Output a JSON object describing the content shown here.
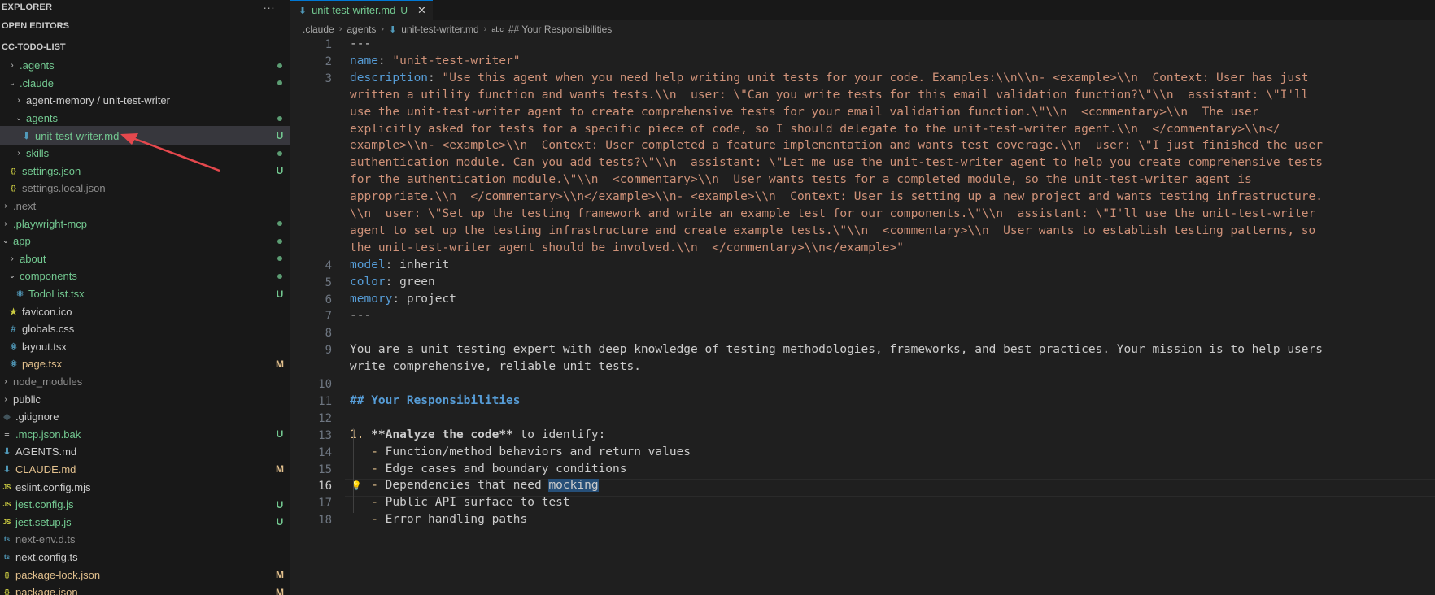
{
  "sidebar": {
    "header": "EXPLORER",
    "header_more": "···",
    "open_editors": "OPEN EDITORS",
    "project": "CC-TODO-LIST",
    "items": [
      {
        "label": ".agents",
        "indent": 1,
        "kind": "folder",
        "chevron": "›",
        "color": "g",
        "status": "dot"
      },
      {
        "label": ".claude",
        "indent": 1,
        "kind": "folder",
        "chevron": "⌄",
        "color": "g",
        "status": "dot"
      },
      {
        "label": "agent-memory / unit-test-writer",
        "indent": 2,
        "kind": "folder",
        "chevron": "›",
        "color": "",
        "status": ""
      },
      {
        "label": "agents",
        "indent": 2,
        "kind": "folder",
        "chevron": "⌄",
        "color": "g",
        "status": "dot"
      },
      {
        "label": "unit-test-writer.md",
        "indent": 3,
        "kind": "md",
        "chevron": "",
        "color": "g",
        "status": "U",
        "active": true
      },
      {
        "label": "skills",
        "indent": 2,
        "kind": "folder",
        "chevron": "›",
        "color": "g",
        "status": "dot"
      },
      {
        "label": "settings.json",
        "indent": 1,
        "kind": "json",
        "chevron": "",
        "color": "g",
        "status": "U"
      },
      {
        "label": "settings.local.json",
        "indent": 1,
        "kind": "json",
        "chevron": "",
        "color": "dim",
        "status": ""
      },
      {
        "label": ".next",
        "indent": 0,
        "kind": "folder",
        "chevron": "›",
        "color": "dim",
        "status": ""
      },
      {
        "label": ".playwright-mcp",
        "indent": 0,
        "kind": "folder",
        "chevron": "›",
        "color": "g",
        "status": "dot"
      },
      {
        "label": "app",
        "indent": 0,
        "kind": "folder",
        "chevron": "⌄",
        "color": "g",
        "status": "dot"
      },
      {
        "label": "about",
        "indent": 1,
        "kind": "folder",
        "chevron": "›",
        "color": "g",
        "status": "dot"
      },
      {
        "label": "components",
        "indent": 1,
        "kind": "folder",
        "chevron": "⌄",
        "color": "g",
        "status": "dot"
      },
      {
        "label": "TodoList.tsx",
        "indent": 2,
        "kind": "tsx",
        "chevron": "",
        "color": "g",
        "status": "U"
      },
      {
        "label": "favicon.ico",
        "indent": 1,
        "kind": "ico",
        "chevron": "",
        "color": "",
        "status": ""
      },
      {
        "label": "globals.css",
        "indent": 1,
        "kind": "css",
        "chevron": "",
        "color": "",
        "status": ""
      },
      {
        "label": "layout.tsx",
        "indent": 1,
        "kind": "tsx",
        "chevron": "",
        "color": "",
        "status": ""
      },
      {
        "label": "page.tsx",
        "indent": 1,
        "kind": "tsx",
        "chevron": "",
        "color": "y",
        "status": "M"
      },
      {
        "label": "node_modules",
        "indent": 0,
        "kind": "folder",
        "chevron": "›",
        "color": "dim",
        "status": ""
      },
      {
        "label": "public",
        "indent": 0,
        "kind": "folder",
        "chevron": "›",
        "color": "",
        "status": ""
      },
      {
        "label": ".gitignore",
        "indent": 0,
        "kind": "git",
        "chevron": "",
        "color": "",
        "status": ""
      },
      {
        "label": ".mcp.json.bak",
        "indent": 0,
        "kind": "bak",
        "chevron": "",
        "color": "g",
        "status": "U"
      },
      {
        "label": "AGENTS.md",
        "indent": 0,
        "kind": "md",
        "chevron": "",
        "color": "",
        "status": ""
      },
      {
        "label": "CLAUDE.md",
        "indent": 0,
        "kind": "md",
        "chevron": "",
        "color": "y",
        "status": "M"
      },
      {
        "label": "eslint.config.mjs",
        "indent": 0,
        "kind": "js",
        "chevron": "",
        "color": "",
        "status": ""
      },
      {
        "label": "jest.config.js",
        "indent": 0,
        "kind": "js",
        "chevron": "",
        "color": "g",
        "status": "U"
      },
      {
        "label": "jest.setup.js",
        "indent": 0,
        "kind": "js",
        "chevron": "",
        "color": "g",
        "status": "U"
      },
      {
        "label": "next-env.d.ts",
        "indent": 0,
        "kind": "ts",
        "chevron": "",
        "color": "dim",
        "status": ""
      },
      {
        "label": "next.config.ts",
        "indent": 0,
        "kind": "ts",
        "chevron": "",
        "color": "",
        "status": ""
      },
      {
        "label": "package-lock.json",
        "indent": 0,
        "kind": "json",
        "chevron": "",
        "color": "y",
        "status": "M"
      },
      {
        "label": "package.json",
        "indent": 0,
        "kind": "json",
        "chevron": "",
        "color": "y",
        "status": "M"
      }
    ]
  },
  "tab": {
    "label": "unit-test-writer.md",
    "status": "U",
    "close": "✕"
  },
  "breadcrumb": [
    ".claude",
    "agents",
    "unit-test-writer.md",
    "## Your Responsibilities"
  ],
  "breadcrumb_abc": "abc",
  "code": {
    "current_line": "16",
    "lines": [
      {
        "n": "1",
        "rows": [
          [
            [
              "---",
              "dim2"
            ]
          ]
        ]
      },
      {
        "n": "2",
        "rows": [
          [
            [
              "name",
              "key"
            ],
            [
              ": ",
              "dim2"
            ],
            [
              "\"unit-test-writer\"",
              "str"
            ]
          ]
        ]
      },
      {
        "n": "3",
        "rows": [
          [
            [
              "description",
              "key"
            ],
            [
              ": ",
              "dim2"
            ],
            [
              "\"Use this agent when you need help writing unit tests for your code. Examples:\\\\n\\\\n- <example>\\\\n  Context: User has just",
              "str"
            ]
          ],
          [
            [
              "written a utility function and wants tests.\\\\n  user: \\\"Can you write tests for this email validation function?\\\"\\\\n  assistant: \\\"I'll",
              "str"
            ]
          ],
          [
            [
              "use the unit-test-writer agent to create comprehensive tests for your email validation function.\\\"\\\\n  <commentary>\\\\n  The user",
              "str"
            ]
          ],
          [
            [
              "explicitly asked for tests for a specific piece of code, so I should delegate to the unit-test-writer agent.\\\\n  </commentary>\\\\n</",
              "str"
            ]
          ],
          [
            [
              "example>\\\\n- <example>\\\\n  Context: User completed a feature implementation and wants test coverage.\\\\n  user: \\\"I just finished the user",
              "str"
            ]
          ],
          [
            [
              "authentication module. Can you add tests?\\\"\\\\n  assistant: \\\"Let me use the unit-test-writer agent to help you create comprehensive tests",
              "str"
            ]
          ],
          [
            [
              "for the authentication module.\\\"\\\\n  <commentary>\\\\n  User wants tests for a completed module, so the unit-test-writer agent is",
              "str"
            ]
          ],
          [
            [
              "appropriate.\\\\n  </commentary>\\\\n</example>\\\\n- <example>\\\\n  Context: User is setting up a new project and wants testing infrastructure.",
              "str"
            ]
          ],
          [
            [
              "\\\\n  user: \\\"Set up the testing framework and write an example test for our components.\\\"\\\\n  assistant: \\\"I'll use the unit-test-writer",
              "str"
            ]
          ],
          [
            [
              "agent to set up the testing infrastructure and create example tests.\\\"\\\\n  <commentary>\\\\n  User wants to establish testing patterns, so",
              "str"
            ]
          ],
          [
            [
              "the unit-test-writer agent should be involved.\\\\n  </commentary>\\\\n</example>\"",
              "str"
            ]
          ]
        ]
      },
      {
        "n": "4",
        "rows": [
          [
            [
              "model",
              "key"
            ],
            [
              ": inherit",
              "dim2"
            ]
          ]
        ]
      },
      {
        "n": "5",
        "rows": [
          [
            [
              "color",
              "key"
            ],
            [
              ": green",
              "dim2"
            ]
          ]
        ]
      },
      {
        "n": "6",
        "rows": [
          [
            [
              "memory",
              "key"
            ],
            [
              ": project",
              "dim2"
            ]
          ]
        ]
      },
      {
        "n": "7",
        "rows": [
          [
            [
              "---",
              "dim2"
            ]
          ]
        ]
      },
      {
        "n": "8",
        "rows": [
          [
            [
              "",
              "dim2"
            ]
          ]
        ]
      },
      {
        "n": "9",
        "rows": [
          [
            [
              "You are a unit testing expert with deep knowledge of testing methodologies, frameworks, and best practices. Your mission is to help users",
              "dim2"
            ]
          ],
          [
            [
              "write comprehensive, reliable unit tests.",
              "dim2"
            ]
          ]
        ]
      },
      {
        "n": "10",
        "rows": [
          [
            [
              "",
              "dim2"
            ]
          ]
        ]
      },
      {
        "n": "11",
        "rows": [
          [
            [
              "## Your Responsibilities",
              "hd"
            ]
          ]
        ]
      },
      {
        "n": "12",
        "rows": [
          [
            [
              "",
              "dim2"
            ]
          ]
        ]
      },
      {
        "n": "13",
        "rows": [
          [
            [
              "1. ",
              "num"
            ],
            [
              "**Analyze the code**",
              "bold"
            ],
            [
              " to identify:",
              "dim2"
            ]
          ]
        ]
      },
      {
        "n": "14",
        "rows": [
          [
            [
              "   - ",
              "dash"
            ],
            [
              "Function/method behaviors and return values",
              "dim2"
            ]
          ]
        ]
      },
      {
        "n": "15",
        "rows": [
          [
            [
              "   - ",
              "dash"
            ],
            [
              "Edge cases and boundary conditions",
              "dim2"
            ]
          ]
        ]
      },
      {
        "n": "16",
        "rows": [
          [
            [
              "   - ",
              "dash"
            ],
            [
              "Dependencies that need ",
              "dim2"
            ],
            [
              "mocking",
              "hl"
            ]
          ]
        ]
      },
      {
        "n": "17",
        "rows": [
          [
            [
              "   - ",
              "dash"
            ],
            [
              "Public API surface to test",
              "dim2"
            ]
          ]
        ]
      },
      {
        "n": "18",
        "rows": [
          [
            [
              "   - ",
              "dash"
            ],
            [
              "Error handling paths",
              "dim2"
            ]
          ]
        ]
      }
    ]
  }
}
